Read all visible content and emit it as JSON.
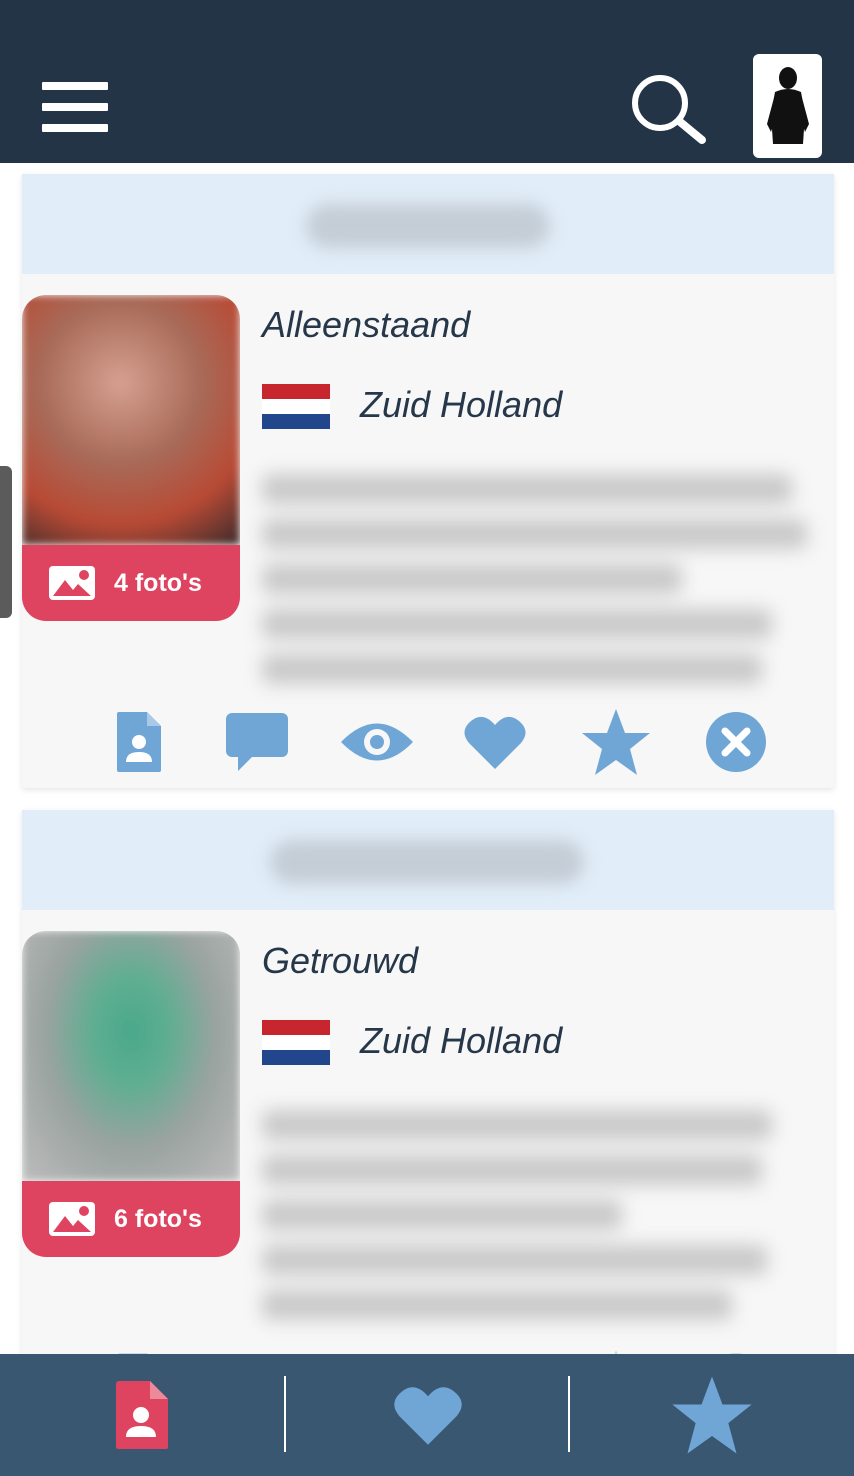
{
  "header": {
    "menu_icon": "hamburger-menu-icon",
    "search_icon": "search-icon",
    "avatar_icon": "male-silhouette-avatar"
  },
  "profiles": [
    {
      "status": "Alleenstaand",
      "region": "Zuid Holland",
      "flag": "netherlands-flag",
      "photos_label": "4 foto's"
    },
    {
      "status": "Getrouwd",
      "region": "Zuid Holland",
      "flag": "netherlands-flag",
      "photos_label": "6 foto's"
    }
  ],
  "card_actions": [
    "profile-icon",
    "message-icon",
    "eye-icon",
    "heart-icon",
    "star-icon",
    "close-circle-icon"
  ],
  "bottom_nav": [
    "profile-icon",
    "heart-icon",
    "star-icon"
  ],
  "colors": {
    "topbar": "#233446",
    "bottombar": "#395771",
    "card_header": "#e1edf8",
    "card_body": "#f7f7f7",
    "photo_badge": "#de4460",
    "action_icon": "#6fa6d6",
    "text": "#26374a",
    "flag_red": "#c8262f",
    "flag_white": "#ffffff",
    "flag_blue": "#21468b"
  }
}
